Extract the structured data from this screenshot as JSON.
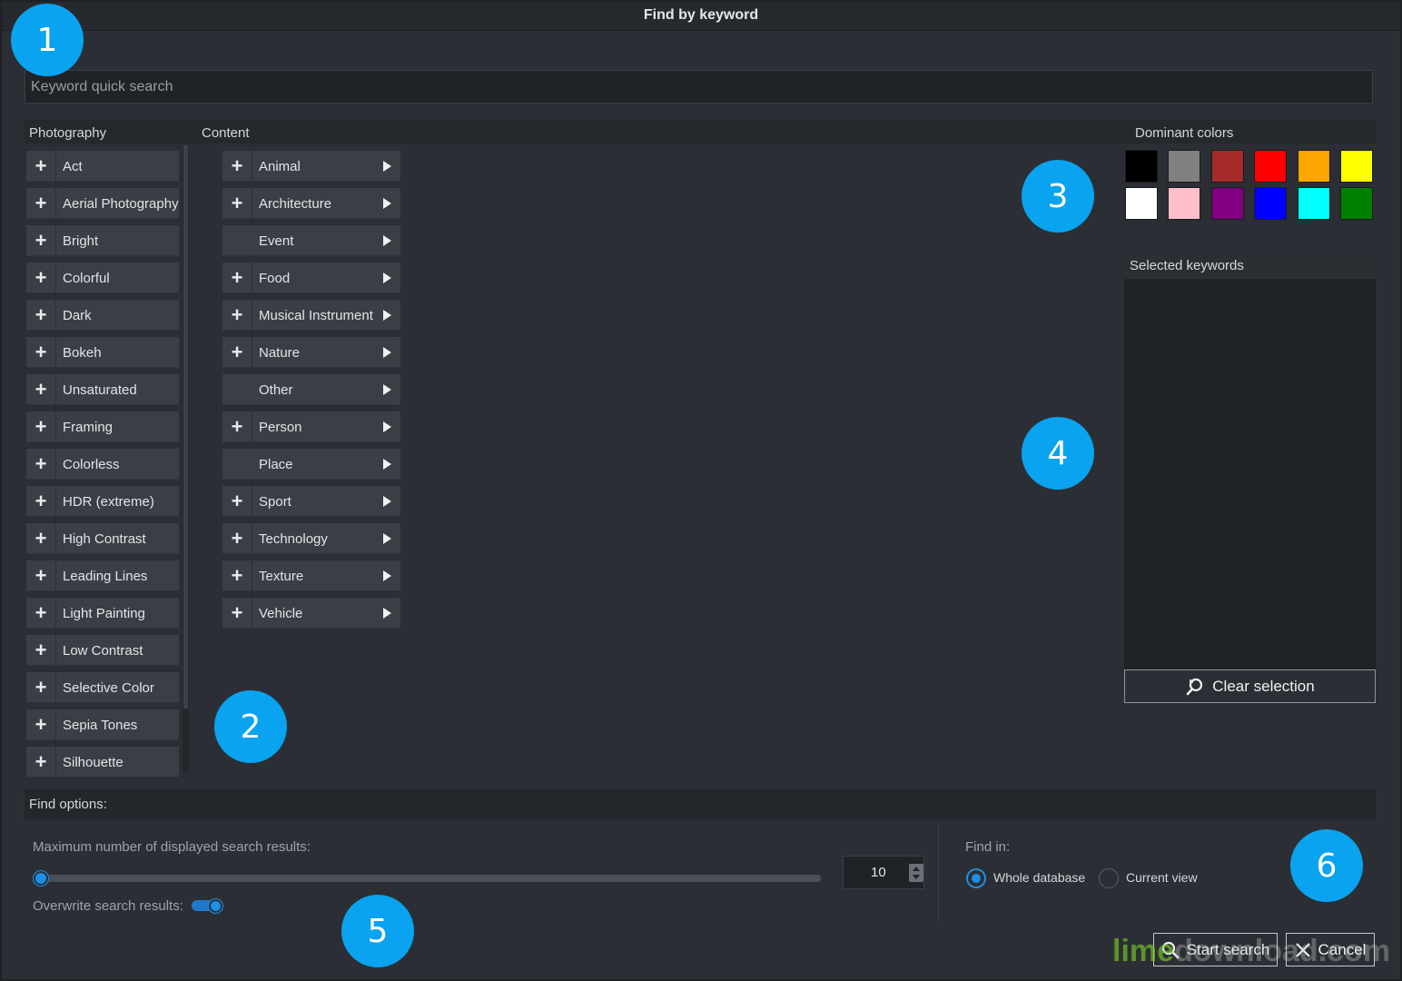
{
  "window": {
    "title": "Find by keyword"
  },
  "search": {
    "placeholder": "Keyword quick search"
  },
  "headers": {
    "photography": "Photography",
    "content": "Content",
    "dominant_colors": "Dominant colors"
  },
  "photography": [
    "Act",
    "Aerial Photography",
    "Bright",
    "Colorful",
    "Dark",
    "Bokeh",
    "Unsaturated",
    "Framing",
    "Colorless",
    "HDR (extreme)",
    "High Contrast",
    "Leading Lines",
    "Light Painting",
    "Low Contrast",
    "Selective Color",
    "Sepia Tones",
    "Silhouette"
  ],
  "content": [
    {
      "label": "Animal",
      "plus": true
    },
    {
      "label": "Architecture",
      "plus": true
    },
    {
      "label": "Event",
      "plus": false
    },
    {
      "label": "Food",
      "plus": true
    },
    {
      "label": "Musical Instrument",
      "plus": true
    },
    {
      "label": "Nature",
      "plus": true
    },
    {
      "label": "Other",
      "plus": false
    },
    {
      "label": "Person",
      "plus": true
    },
    {
      "label": "Place",
      "plus": false
    },
    {
      "label": "Sport",
      "plus": true
    },
    {
      "label": "Technology",
      "plus": true
    },
    {
      "label": "Texture",
      "plus": true
    },
    {
      "label": "Vehicle",
      "plus": true
    }
  ],
  "colors": [
    "#000000",
    "#808080",
    "#a52a2a",
    "#ff0000",
    "#ffa500",
    "#ffff00",
    "#ffffff",
    "#ffc0cb",
    "#800080",
    "#0000ff",
    "#00ffff",
    "#008000"
  ],
  "selected_keywords": {
    "header": "Selected keywords",
    "clear_label": "Clear selection"
  },
  "find_options": {
    "header": "Find options:",
    "max_results_label": "Maximum number of displayed search results:",
    "max_results_value": "10",
    "overwrite_label": "Overwrite search results:",
    "overwrite_on": true,
    "find_in_label": "Find in:",
    "find_in": [
      {
        "label": "Whole database",
        "selected": true
      },
      {
        "label": "Current view",
        "selected": false
      }
    ]
  },
  "actions": {
    "start_label": "Start search",
    "cancel_label": "Cancel"
  },
  "callouts": [
    "1",
    "2",
    "3",
    "4",
    "5",
    "6"
  ],
  "watermark": {
    "part1": "lime",
    "part2": "download.com"
  }
}
